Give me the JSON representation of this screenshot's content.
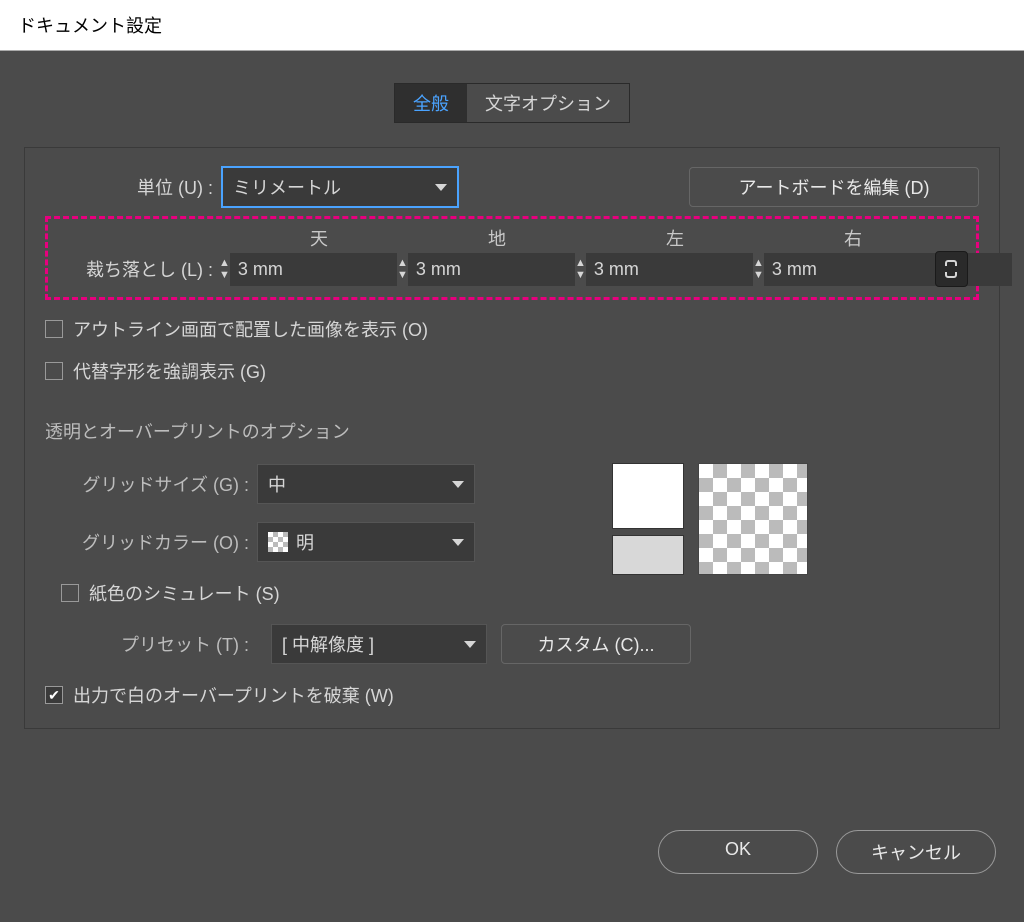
{
  "title": "ドキュメント設定",
  "tabs": {
    "general": "全般",
    "typeOptions": "文字オプション"
  },
  "units": {
    "label": "単位 (U) :",
    "value": "ミリメートル"
  },
  "editArtboard": "アートボードを編集 (D)",
  "bleed": {
    "label": "裁ち落とし (L) :",
    "headers": {
      "top": "天",
      "bottom": "地",
      "left": "左",
      "right": "右"
    },
    "values": {
      "top": "3 mm",
      "bottom": "3 mm",
      "left": "3 mm",
      "right": "3 mm"
    }
  },
  "checkboxes": {
    "outlineImages": "アウトライン画面で配置した画像を表示 (O)",
    "altGlyphs": "代替字形を強調表示 (G)",
    "simulatePaper": "紙色のシミュレート (S)",
    "discardWhiteOP": "出力で白のオーバープリントを破棄 (W)"
  },
  "transparency": {
    "title": "透明とオーバープリントのオプション",
    "gridSizeLabel": "グリッドサイズ (G) :",
    "gridSizeValue": "中",
    "gridColorLabel": "グリッドカラー (O) :",
    "gridColorValue": "明",
    "presetLabel": "プリセット (T) :",
    "presetValue": "[ 中解像度 ]",
    "customBtn": "カスタム (C)..."
  },
  "footer": {
    "ok": "OK",
    "cancel": "キャンセル"
  }
}
